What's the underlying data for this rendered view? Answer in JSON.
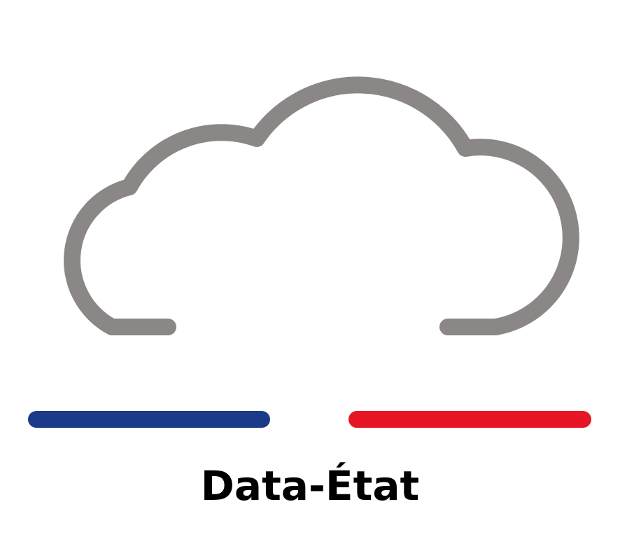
{
  "logo": {
    "name": "Data-État",
    "icon": "cloud-icon",
    "colors": {
      "cloud": "#8b8787",
      "stripe_left": "#1b3a87",
      "stripe_right": "#e61624",
      "text": "#000000"
    }
  }
}
